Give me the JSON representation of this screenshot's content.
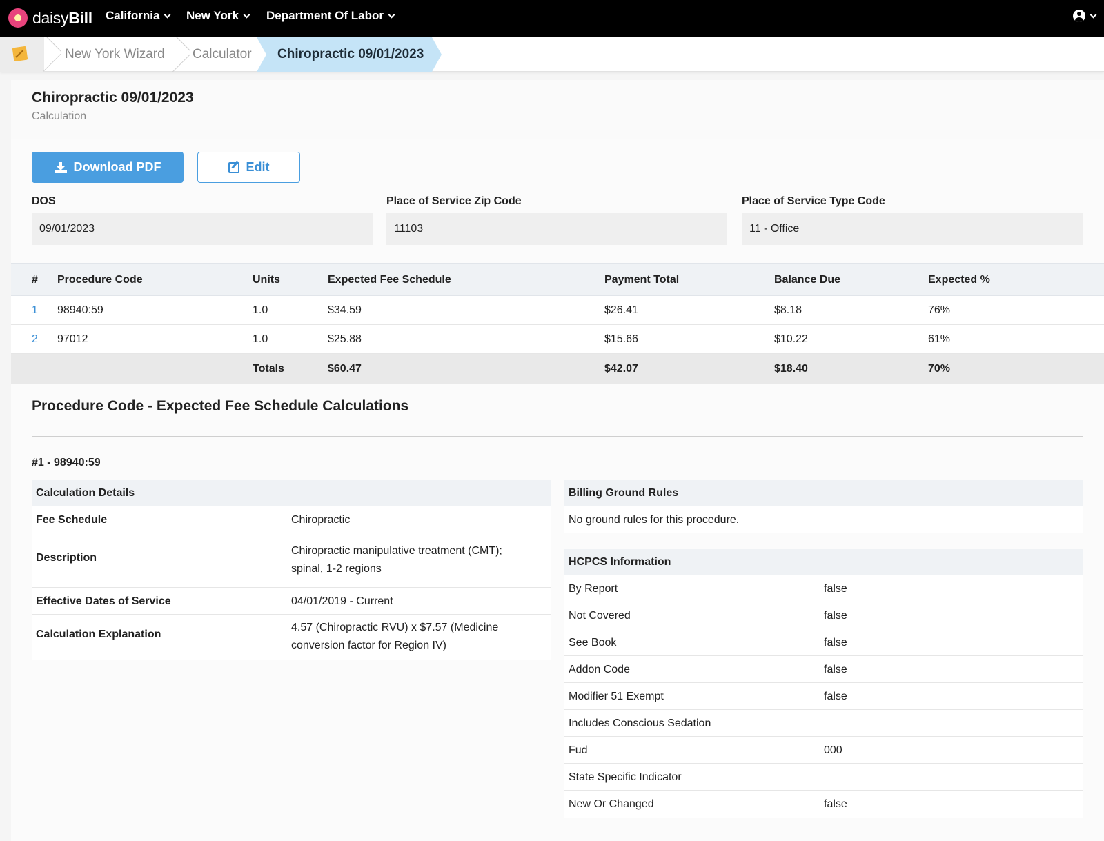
{
  "nav": {
    "logo_light": "daisy",
    "logo_bold": "Bill",
    "items": [
      {
        "label": "California"
      },
      {
        "label": "New York"
      },
      {
        "label": "Department Of Labor"
      }
    ]
  },
  "breadcrumb": {
    "items": [
      "New York Wizard",
      "Calculator"
    ],
    "active": "Chiropractic 09/01/2023"
  },
  "header": {
    "title": "Chiropractic 09/01/2023",
    "subtitle": "Calculation"
  },
  "actions": {
    "download_label": "Download PDF",
    "edit_label": "Edit"
  },
  "fields": {
    "dos": {
      "label": "DOS",
      "value": "09/01/2023"
    },
    "zip": {
      "label": "Place of Service Zip Code",
      "value": "11103"
    },
    "type": {
      "label": "Place of Service Type Code",
      "value": "11 - Office"
    }
  },
  "table": {
    "columns": [
      "#",
      "Procedure Code",
      "Units",
      "Expected Fee Schedule",
      "Payment Total",
      "Balance Due",
      "Expected %"
    ],
    "rows": [
      {
        "num": "1",
        "code": "98940:59",
        "units": "1.0",
        "fee": "$34.59",
        "payment": "$26.41",
        "balance": "$8.18",
        "pct": "76%"
      },
      {
        "num": "2",
        "code": "97012",
        "units": "1.0",
        "fee": "$25.88",
        "payment": "$15.66",
        "balance": "$10.22",
        "pct": "61%"
      }
    ],
    "totals": {
      "label": "Totals",
      "fee": "$60.47",
      "payment": "$42.07",
      "balance": "$18.40",
      "pct": "70%"
    }
  },
  "calc_section": {
    "title": "Procedure Code - Expected Fee Schedule Calculations",
    "procedure_title": "#1 - 98940:59",
    "details": {
      "heading": "Calculation Details",
      "rows": [
        {
          "label": "Fee Schedule",
          "value": "Chiropractic"
        },
        {
          "label": "Description",
          "value": "Chiropractic manipulative treatment (CMT); spinal, 1-2 regions"
        },
        {
          "label": "Effective Dates of Service",
          "value": "04/01/2019 - Current"
        },
        {
          "label": "Calculation Explanation",
          "value": "4.57 (Chiropractic RVU) x $7.57 (Medicine conversion factor for Region IV)"
        }
      ]
    },
    "ground_rules": {
      "heading": "Billing Ground Rules",
      "text": "No ground rules for this procedure."
    },
    "hcpcs": {
      "heading": "HCPCS Information",
      "rows": [
        {
          "label": "By Report",
          "value": "false"
        },
        {
          "label": "Not Covered",
          "value": "false"
        },
        {
          "label": "See Book",
          "value": "false"
        },
        {
          "label": "Addon Code",
          "value": "false"
        },
        {
          "label": "Modifier 51 Exempt",
          "value": "false"
        },
        {
          "label": "Includes Conscious Sedation",
          "value": ""
        },
        {
          "label": "Fud",
          "value": "000"
        },
        {
          "label": "State Specific Indicator",
          "value": ""
        },
        {
          "label": "New Or Changed",
          "value": "false"
        }
      ]
    }
  }
}
